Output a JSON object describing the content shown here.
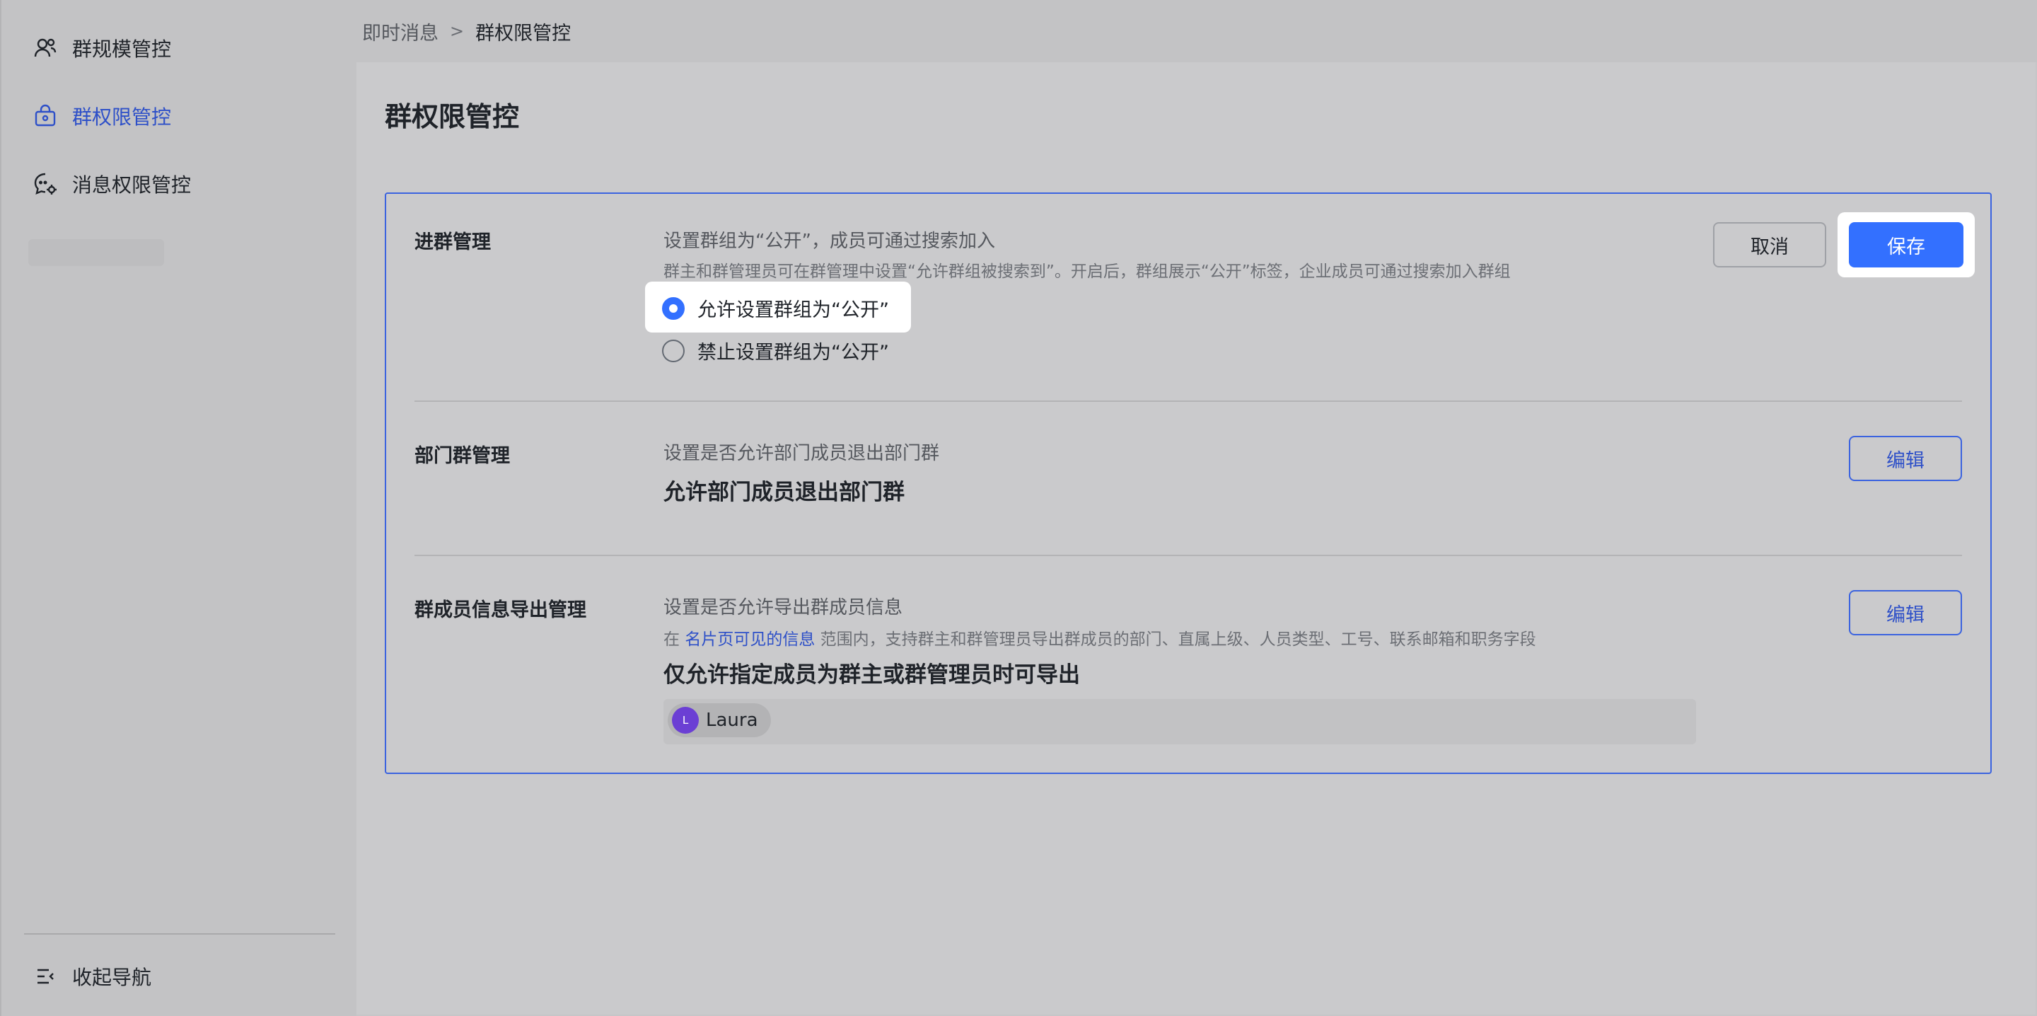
{
  "sidebar": {
    "items": [
      {
        "label": "群规模管控",
        "icon": "users-icon"
      },
      {
        "label": "群权限管控",
        "icon": "lock-bag-icon",
        "active": true
      },
      {
        "label": "消息权限管控",
        "icon": "message-settings-icon"
      }
    ],
    "collapse_label": "收起导航"
  },
  "breadcrumb": {
    "parent": "即时消息",
    "separator": ">",
    "current": "群权限管控"
  },
  "page": {
    "title": "群权限管控"
  },
  "sections": {
    "join": {
      "label": "进群管理",
      "desc": "设置群组为“公开”，成员可通过搜索加入",
      "subdesc": "群主和群管理员可在群管理中设置“允许群组被搜索到”。开启后，群组展示“公开”标签，企业成员可通过搜索加入群组",
      "options": [
        {
          "label": "允许设置群组为“公开”",
          "checked": true
        },
        {
          "label": "禁止设置群组为“公开”",
          "checked": false
        }
      ],
      "cancel_label": "取消",
      "save_label": "保存"
    },
    "department": {
      "label": "部门群管理",
      "desc": "设置是否允许部门成员退出部门群",
      "value": "允许部门成员退出部门群",
      "edit_label": "编辑"
    },
    "export": {
      "label": "群成员信息导出管理",
      "desc": "设置是否允许导出群成员信息",
      "subdesc_prefix": "在",
      "subdesc_link": "名片页可见的信息",
      "subdesc_suffix": "范围内，支持群主和群管理员导出群成员的部门、直属上级、人员类型、工号、联系邮箱和职务字段",
      "value": "仅允许指定成员为群主或群管理员时可导出",
      "member": {
        "initial": "L",
        "name": "Laura"
      },
      "edit_label": "编辑"
    }
  },
  "colors": {
    "accent": "#3370ff",
    "border_accent": "#3b63df",
    "link": "#2e50c8",
    "avatar": "#6b3fd4"
  }
}
